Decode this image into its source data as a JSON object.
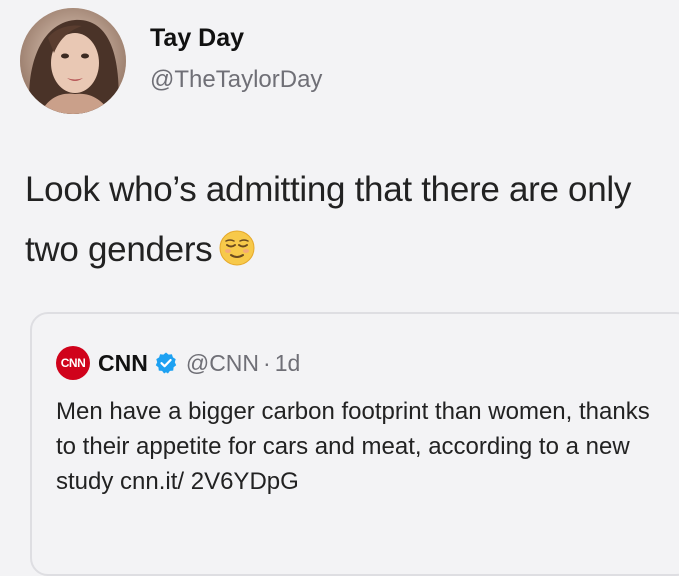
{
  "author": {
    "name": "Tay Day",
    "handle": "@TheTaylorDay",
    "avatar_icon": "profile-photo"
  },
  "tweet": {
    "text": "Look who’s admitting that there are only two genders",
    "emoji_icon": "relieved-face-emoji"
  },
  "quoted_tweet": {
    "logo_text": "CNN",
    "name": "CNN",
    "verified_icon": "verified-badge-icon",
    "handle": "@CNN",
    "separator": "·",
    "time": "1d",
    "text": "Men have a bigger carbon footprint than women, thanks to their appetite for cars and meat, according to a new study cnn.it/ 2V6YDpG"
  },
  "colors": {
    "background": "#f3f3f5",
    "cnn_red": "#d0021b",
    "verified_blue": "#1da1f2",
    "secondary_text": "#6f6f76"
  }
}
